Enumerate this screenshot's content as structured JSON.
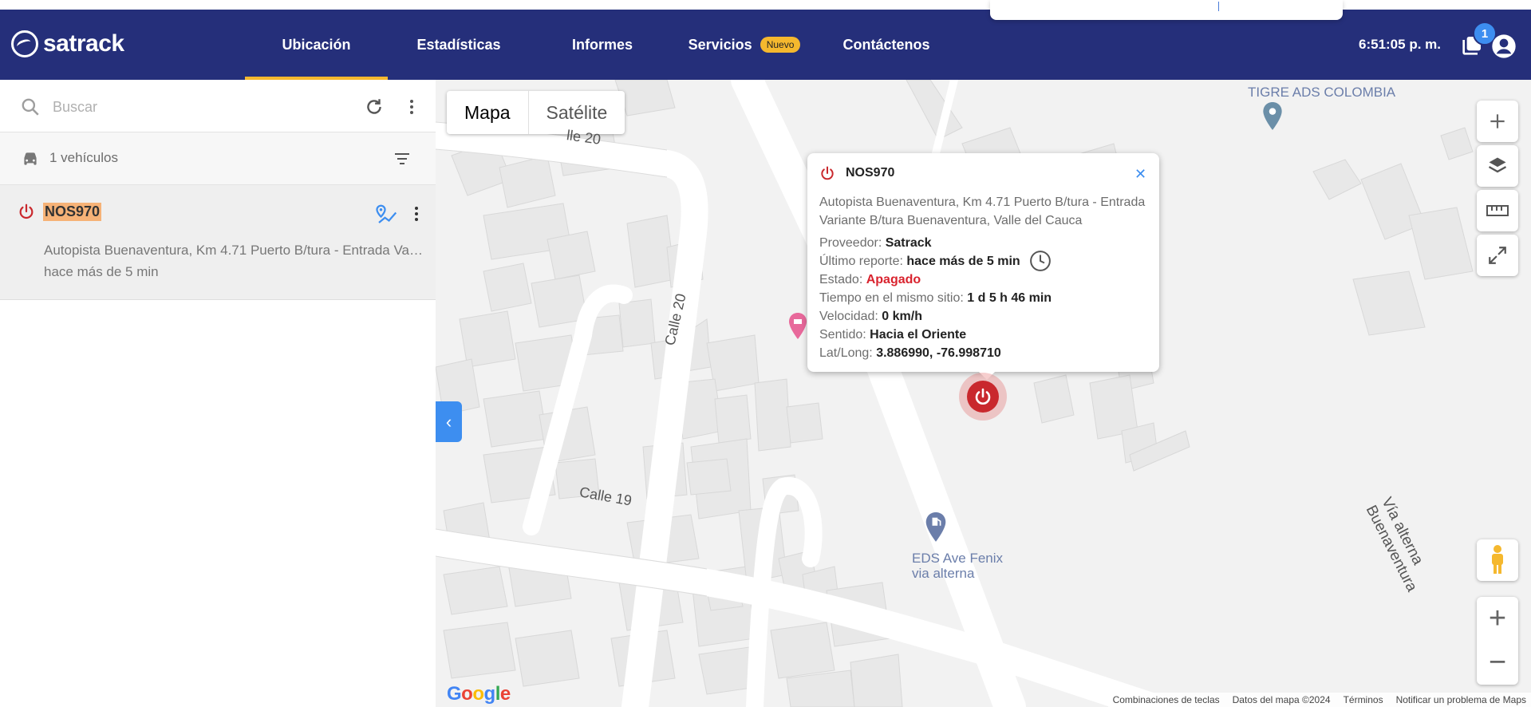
{
  "brand": {
    "name": "satrack"
  },
  "nav": {
    "items": [
      {
        "label": "Ubicación",
        "active": true
      },
      {
        "label": "Estadísticas"
      },
      {
        "label": "Informes"
      },
      {
        "label": "Servicios",
        "badge": "Nuevo"
      },
      {
        "label": "Contáctenos"
      }
    ],
    "time": "6:51:05 p. m.",
    "notification_count": "1"
  },
  "sidebar": {
    "search_placeholder": "Buscar",
    "vehicles_count": "1 vehículos",
    "vehicles": [
      {
        "plate": "NOS970",
        "address": "Autopista Buenaventura, Km 4.71 Puerto B/tura - Entrada Variante B/tura Buenaventura, Valle del Cauca",
        "time": "hace más de 5 min"
      }
    ]
  },
  "map": {
    "type_toggle": {
      "map": "Mapa",
      "satellite": "Satélite"
    },
    "labels": {
      "calle20_top": "lle 20",
      "calle20": "Calle 20",
      "calle19": "Calle 19",
      "via": "Vía alterna Buenaventura"
    },
    "pois": {
      "tigre": "TIGRE ADS COLOMBIA",
      "eds": "EDS Ave Fenix\nvia alterna"
    },
    "footer": {
      "shortcuts": "Combinaciones de teclas",
      "data": "Datos del mapa ©2024",
      "terms": "Términos",
      "report": "Notificar un problema de Maps"
    },
    "google": "Google"
  },
  "popup": {
    "plate": "NOS970",
    "address": "Autopista Buenaventura, Km 4.71 Puerto B/tura - Entrada Variante B/tura Buenaventura, Valle del Cauca",
    "rows": [
      {
        "label": "Proveedor:",
        "value": "Satrack"
      },
      {
        "label": "Último reporte:",
        "value": "hace más de 5 min"
      },
      {
        "label": "Estado:",
        "value": "Apagado"
      },
      {
        "label": "Tiempo en el mismo sitio:",
        "value": "1 d 5 h 46 min"
      },
      {
        "label": "Velocidad:",
        "value": "0 km/h"
      },
      {
        "label": "Sentido:",
        "value": "Hacia el Oriente"
      },
      {
        "label": "Lat/Long:",
        "value": "3.886990, -76.998710"
      }
    ]
  },
  "colors": {
    "navbar": "#252f7a",
    "accent": "#f5b82e",
    "primary": "#3d8ef0",
    "off": "#c9282d"
  }
}
